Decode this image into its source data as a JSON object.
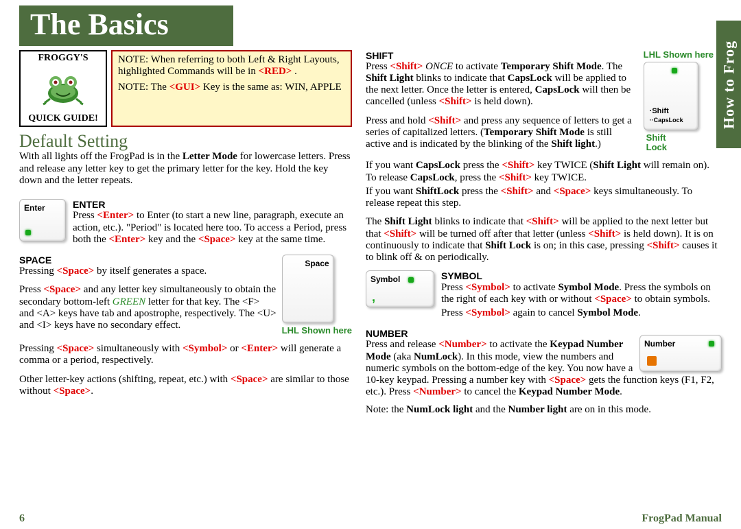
{
  "title": "The Basics",
  "side_tab": "How to Frog",
  "quick_guide": {
    "top": "FROGGY'S",
    "bottom": "QUICK GUIDE!"
  },
  "notes": {
    "line1_a": "NOTE: When referring to both Left & Right Layouts, highlighted Commands will be in ",
    "line1_b": "<RED>",
    "line1_c": " .",
    "line2_a": "NOTE: The ",
    "line2_b": "<GUI>",
    "line2_c": " Key is the same as: WIN, APPLE"
  },
  "default": {
    "heading": "Default Setting",
    "p1_a": "With all lights off the FrogPad is in the ",
    "p1_b": "Letter Mode",
    "p1_c": " for lowercase letters.  Press and release any letter key to get the primary letter for the key.  Hold the key down and the letter repeats."
  },
  "enter": {
    "head": "ENTER",
    "key": "Enter",
    "p_a": "Press ",
    "p_b": "<Enter>",
    "p_c": " to Enter (to start a new line, paragraph, execute an action, etc.).  \"Period\" is located here too.  To access a Period, press both the ",
    "p_d": "<Enter>",
    "p_e": " key and the ",
    "p_f": "<Space>",
    "p_g": " key at the same time."
  },
  "space": {
    "head": "SPACE",
    "key": "Space",
    "lhl": "LHL Shown here",
    "p1_a": "Pressing ",
    "p1_b": "<Space>",
    "p1_c": " by itself generates a space.",
    "p2_a": "Press ",
    "p2_b": "<Space>",
    "p2_c": " and any letter key simultaneously to obtain the secondary bottom-left ",
    "p2_d": "GREEN",
    "p2_e": " letter for that key.  The <F> and <A> keys have tab and apostrophe, respectively.  The <U> and <I> keys have no secondary effect.",
    "p3_a": "Pressing ",
    "p3_b": "<Space>",
    "p3_c": " simultaneously with ",
    "p3_d": "<Symbol>",
    "p3_e": " or ",
    "p3_f": "<Enter>",
    "p3_g": " will generate a comma or a period, respectively.",
    "p4_a": "Other letter-key actions (shifting, repeat, etc.) with ",
    "p4_b": "<Space>",
    "p4_c": " are similar to those without ",
    "p4_d": "<Space>",
    "p4_e": "."
  },
  "shift": {
    "head": "SHIFT",
    "lhl": "LHL Shown here",
    "key_label": "·Shift",
    "key_sub": "··CapsLock",
    "below": "Shift\nLock",
    "p1_a": "Press ",
    "p1_b": "<Shift>",
    "p1_c": " ",
    "p1_once": "ONCE",
    "p1_d": " to activate ",
    "p1_e": "Temporary Shift Mode",
    "p1_f": ".  The ",
    "p1_g": "Shift Light",
    "p1_h": " blinks to indicate that ",
    "p1_i": "CapsLock",
    "p1_j": " will be applied to the next letter.  Once the letter is entered, ",
    "p1_k": "CapsLock",
    "p1_l": " will then be cancelled (unless ",
    "p1_m": "<Shift>",
    "p1_n": " is held down).",
    "p2_a": "Press and hold ",
    "p2_b": "<Shift>",
    "p2_c": " and press any sequence of letters to get a series of capitalized letters.  (",
    "p2_d": "Temporary Shift Mode",
    "p2_e": " is still active and is indicated by the blinking of the ",
    "p2_f": "Shift light",
    "p2_g": ".)",
    "p3_a": "If you want ",
    "p3_b": "CapsLock",
    "p3_c": " press the ",
    "p3_d": "<Shift>",
    "p3_e": " key TWICE (",
    "p3_f": "Shift Light",
    "p3_g": " will remain on).  To release ",
    "p3_h": "CapsLock",
    "p3_i": ", press the ",
    "p3_j": "<Shift>",
    "p3_k": " key TWICE.",
    "p4_a": "If you want ",
    "p4_b": "ShiftLock",
    "p4_c": " press the ",
    "p4_d": "<Shift>",
    "p4_e": " and ",
    "p4_f": "<Space>",
    "p4_g": " keys simultaneously. To release repeat this step.",
    "p5_a": "The ",
    "p5_b": "Shift Light",
    "p5_c": " blinks to indicate that ",
    "p5_d": "<Shift>",
    "p5_e": " will be applied to the next letter but that ",
    "p5_f": "<Shift>",
    "p5_g": " will be turned off after that letter (unless ",
    "p5_h": "<Shift>",
    "p5_i": " is held down).  It is on continuously to indicate that ",
    "p5_j": "Shift Lock",
    "p5_k": " is on; in this case, pressing ",
    "p5_l": "<Shift>",
    "p5_m": " causes it to blink off & on periodically."
  },
  "symbol": {
    "head": "SYMBOL",
    "key": "Symbol",
    "p_a": "Press ",
    "p_b": "<Symbol>",
    "p_c": " to activate ",
    "p_d": "Symbol Mode",
    "p_e": ".  Press the symbols on the right of each key with or without ",
    "p_f": "<Space>",
    "p_g": " to obtain symbols.",
    "p2_a": "Press ",
    "p2_b": "<Symbol>",
    "p2_c": " again to cancel ",
    "p2_d": "Symbol Mode",
    "p2_e": "."
  },
  "number": {
    "head": "NUMBER",
    "key": "Number",
    "p_a": "Press and release ",
    "p_b": "<Number>",
    "p_c": " to activate the ",
    "p_d": "Keypad Number Mode",
    "p_e": " (aka ",
    "p_f": "NumLock",
    "p_g": ").  In this mode, view the numbers and numeric symbols on the bottom-edge of the key.  You now have a 10-key keypad.  Pressing a number key with ",
    "p_h": "<Space>",
    "p_i": " gets the function keys (F1, F2, etc.).  Press ",
    "p_j": "<Number>",
    "p_k": " to cancel the ",
    "p_l": "Keypad Number Mode",
    "p_m": ".",
    "note_a": "Note: the ",
    "note_b": "NumLock light",
    "note_c": " and the ",
    "note_d": "Number light",
    "note_e": " are on in this mode."
  },
  "footer": {
    "page": "6",
    "manual": "FrogPad Manual"
  }
}
